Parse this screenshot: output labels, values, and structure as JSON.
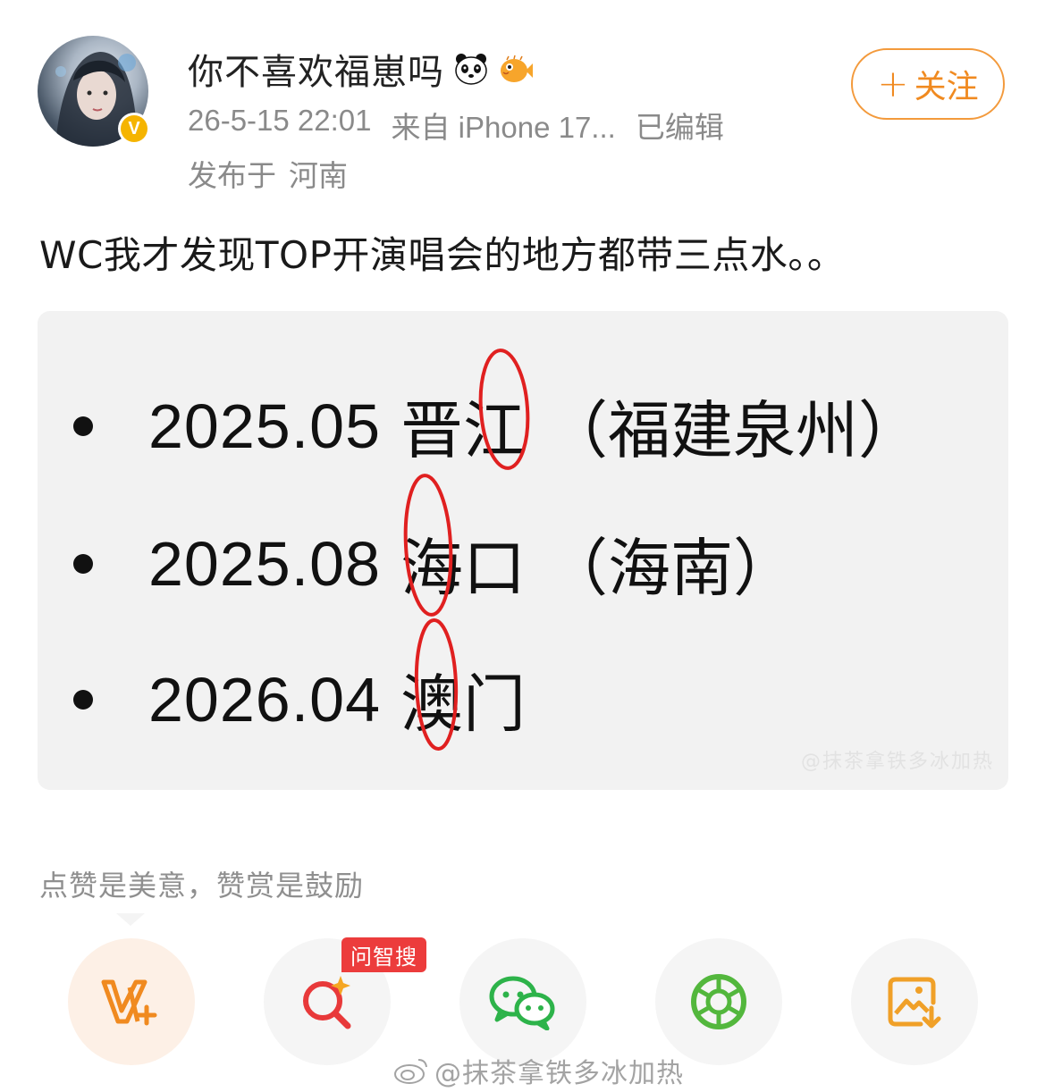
{
  "post": {
    "username": "你不喜欢福崽吗",
    "username_badges": [
      "panda-icon",
      "pufferfish-icon"
    ],
    "timestamp": "26-5-15 22:01",
    "source": "来自 iPhone 17...",
    "edited": "已编辑",
    "location_label": "发布于",
    "location": "河南",
    "follow_label": "关注",
    "follow_plus": "+",
    "text": "WC我才发现TOP开演唱会的地方都带三点水。。",
    "verified_badge": "V"
  },
  "image": {
    "items": [
      {
        "date": "2025.05",
        "place": "晋江",
        "region": "（福建泉州）"
      },
      {
        "date": "2025.08",
        "place": "海口",
        "region": "（海南）"
      },
      {
        "date": "2026.04",
        "place": "澳门",
        "region": ""
      }
    ],
    "watermark": "@抹茶拿铁多冰加热"
  },
  "reward": {
    "text": "点赞是美意，赞赏是鼓励"
  },
  "actions": [
    {
      "name": "vplus-reward",
      "icon": "vplus-icon"
    },
    {
      "name": "ai-search",
      "icon": "search-spark-icon",
      "tag": "问智搜"
    },
    {
      "name": "share-wechat",
      "icon": "wechat-icon"
    },
    {
      "name": "share-moments",
      "icon": "moments-shutter-icon"
    },
    {
      "name": "save-image",
      "icon": "save-image-icon"
    }
  ],
  "watermark": {
    "text": "@抹茶拿铁多冰加热"
  },
  "colors": {
    "accent_orange": "#f08a20",
    "verified_gold": "#f5b400",
    "annotation_red": "#e02020",
    "tag_red": "#ec3c3c",
    "wechat_green": "#2db34a"
  }
}
